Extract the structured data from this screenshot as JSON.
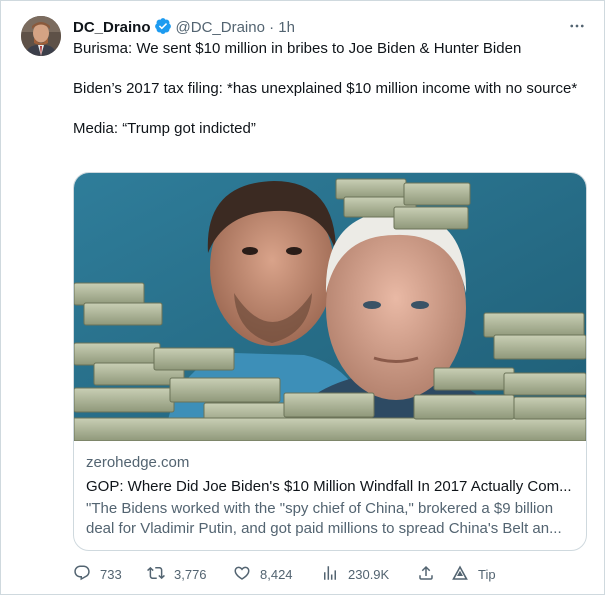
{
  "author": {
    "display_name": "DC_Draino",
    "handle": "@DC_Draino",
    "separator": "·",
    "time": "1h"
  },
  "tweet": {
    "paragraphs": [
      "Burisma: We sent $10 million in bribes to Joe Biden & Hunter Biden",
      "Biden’s 2017 tax filing: *has unexplained $10 million income with no source*",
      "Media: “Trump got indicted”"
    ]
  },
  "link_card": {
    "domain": "zerohedge.com",
    "title": "GOP: Where Did Joe Biden's $10 Million Windfall In 2017 Actually Com...",
    "description": "\"The Bidens worked with the \"spy chief of China,\" brokered a $9 billion deal for Vladimir Putin, and got paid millions to spread China's Belt an..."
  },
  "actions": {
    "replies": "733",
    "retweets": "3,776",
    "likes": "8,424",
    "views": "230.9K",
    "tip_label": "Tip"
  },
  "icons": [
    "verified-badge-icon",
    "more-icon",
    "reply-icon",
    "retweet-icon",
    "like-icon",
    "views-icon",
    "share-icon",
    "tip-icon"
  ],
  "colors": {
    "verified": "#1d9bf0",
    "text": "#0f1419",
    "secondary": "#536471",
    "border": "#cfd9de"
  }
}
